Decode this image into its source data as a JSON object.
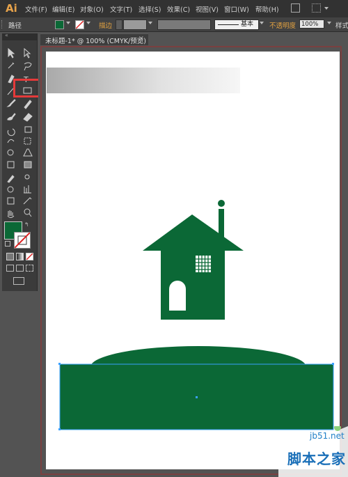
{
  "app": {
    "logo": "Ai"
  },
  "menu": [
    "文件(F)",
    "编辑(E)",
    "对象(O)",
    "文字(T)",
    "选择(S)",
    "效果(C)",
    "视图(V)",
    "窗口(W)",
    "帮助(H)"
  ],
  "control_bar": {
    "object_type": "路径",
    "stroke_label": "描边",
    "stroke_style": "基本",
    "opacity_label": "不透明度",
    "opacity_value": "100%",
    "style_label": "样式"
  },
  "document": {
    "tab_title": "未标题-1* @ 100% (CMYK/预览)",
    "close": "×"
  },
  "colors": {
    "fill": "#0b6836",
    "accent_highlight": "#e53a3a",
    "artboard": "#ffffff"
  },
  "tools": [
    "selection-tool",
    "direct-selection-tool",
    "magic-wand-tool",
    "lasso-tool",
    "pen-tool",
    "type-tool",
    "line-segment-tool",
    "rectangle-tool",
    "paintbrush-tool",
    "pencil-tool",
    "blob-brush-tool",
    "eraser-tool",
    "rotate-tool",
    "scale-tool",
    "width-tool",
    "free-transform-tool",
    "shape-builder-tool",
    "perspective-grid-tool",
    "mesh-tool",
    "gradient-tool",
    "eyedropper-tool",
    "blend-tool",
    "symbol-sprayer-tool",
    "column-graph-tool",
    "artboard-tool",
    "slice-tool",
    "hand-tool",
    "zoom-tool"
  ],
  "watermark": {
    "url": "jb51.net",
    "name": "脚本之家"
  }
}
